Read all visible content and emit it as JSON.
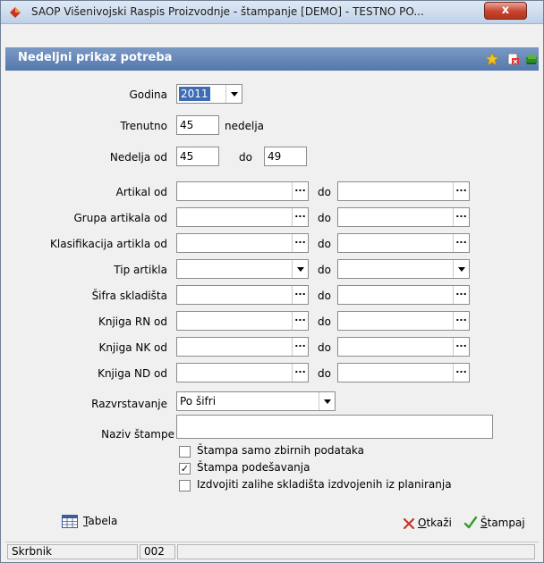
{
  "window": {
    "title": "SAOP  Višenivojski Raspis Proizvodnje - štampanje  [DEMO] - TESTNO PO...",
    "close_label": "x"
  },
  "header": {
    "title": "Nedeljni prikaz potreba",
    "icons": [
      "star-icon",
      "export-icon",
      "books-icon"
    ]
  },
  "form": {
    "godina": {
      "label": "Godina",
      "value": "2011"
    },
    "trenutno": {
      "label": "Trenutno",
      "value": "45",
      "suffix": "nedelja"
    },
    "nedelja": {
      "label": "Nedelja od",
      "from": "45",
      "to_label": "do",
      "to": "49"
    },
    "range_rows": [
      {
        "label": "Artikal od",
        "to_label": "do",
        "from": "",
        "to": "",
        "type": "browse"
      },
      {
        "label": "Grupa artikala od",
        "to_label": "do",
        "from": "",
        "to": "",
        "type": "browse"
      },
      {
        "label": "Klasifikacija artikla od",
        "to_label": "do",
        "from": "",
        "to": "",
        "type": "browse"
      },
      {
        "label": "Tip artikla",
        "to_label": "do",
        "from": "",
        "to": "",
        "type": "dropdown"
      },
      {
        "label": "Šifra skladišta",
        "to_label": "do",
        "from": "",
        "to": "",
        "type": "browse"
      },
      {
        "label": "Knjiga RN od",
        "to_label": "do",
        "from": "",
        "to": "",
        "type": "browse"
      },
      {
        "label": "Knjiga NK od",
        "to_label": "do",
        "from": "",
        "to": "",
        "type": "browse"
      },
      {
        "label": "Knjiga ND od",
        "to_label": "do",
        "from": "",
        "to": "",
        "type": "browse"
      }
    ],
    "browse_glyph": "...",
    "razvrstavanje": {
      "label": "Razvrstavanje",
      "value": "Po šifri"
    },
    "naziv": {
      "label": "Naziv štampe",
      "value": ""
    },
    "checkboxes": [
      {
        "label": "Štampa samo zbirnih podataka",
        "checked": false
      },
      {
        "label": "Štampa podešavanja",
        "checked": true
      },
      {
        "label": "Izdvojiti zalihe skladišta izdvojenih iz planiranja",
        "checked": false
      }
    ],
    "check_mark": "✓"
  },
  "footer": {
    "tabela_first": "T",
    "tabela_rest": "abela",
    "otkazi_first": "O",
    "otkazi_rest": "tkaži",
    "stampaj_first": "Š",
    "stampaj_rest": "tampaj"
  },
  "status": {
    "user": "Skrbnik",
    "code": "002",
    "extra": ""
  },
  "colors": {
    "header_bg": "#5578ad",
    "close_red": "#c7432d",
    "cancel_red": "#c0392b",
    "ok_green": "#3a9a2e"
  }
}
